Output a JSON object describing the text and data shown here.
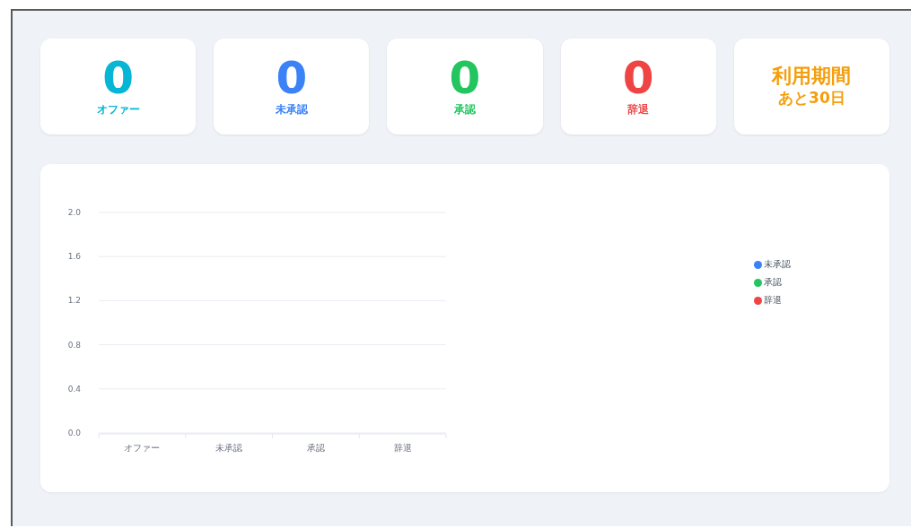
{
  "stats": [
    {
      "kind": "count",
      "value": "0",
      "label": "オファー",
      "color": "#06b6d4"
    },
    {
      "kind": "count",
      "value": "0",
      "label": "未承認",
      "color": "#3b82f6"
    },
    {
      "kind": "count",
      "value": "0",
      "label": "承認",
      "color": "#22c55e"
    },
    {
      "kind": "count",
      "value": "0",
      "label": "辞退",
      "color": "#ef4444"
    },
    {
      "kind": "period",
      "title": "利用期間",
      "value": "あと30日",
      "color": "#f59e0b"
    }
  ],
  "chart": {
    "chart_data": {
      "type": "bar",
      "categories": [
        "オファー",
        "未承認",
        "承認",
        "辞退"
      ],
      "series": [
        {
          "name": "未承認",
          "color": "#3b82f6",
          "values": [
            0,
            0,
            0,
            0
          ]
        },
        {
          "name": "承認",
          "color": "#22c55e",
          "values": [
            0,
            0,
            0,
            0
          ]
        },
        {
          "name": "辞退",
          "color": "#ef4444",
          "values": [
            0,
            0,
            0,
            0
          ]
        }
      ],
      "ylim": [
        0,
        2
      ],
      "grid": true,
      "yticks": [
        {
          "value": 0,
          "label": "0.0"
        },
        {
          "value": 0.4,
          "label": "0.4"
        },
        {
          "value": 0.8,
          "label": "0.8"
        },
        {
          "value": 1.2,
          "label": "1.2"
        },
        {
          "value": 1.6,
          "label": "1.6"
        },
        {
          "value": 2,
          "label": "2.0"
        }
      ]
    }
  }
}
